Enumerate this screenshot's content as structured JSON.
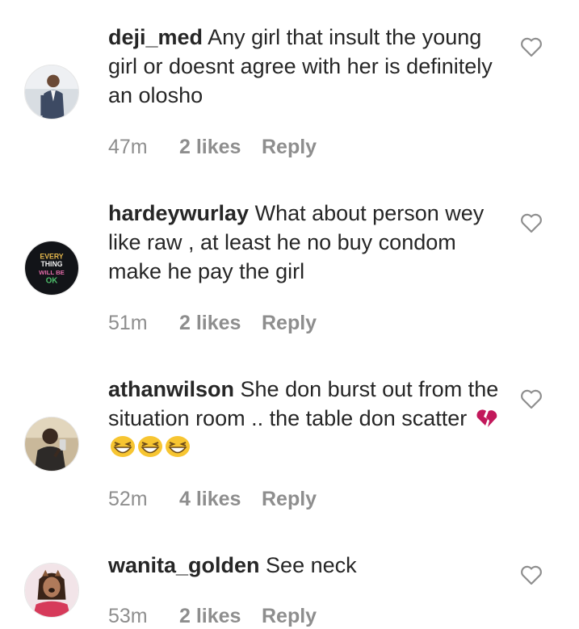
{
  "comments": [
    {
      "username": "deji_med",
      "text": "Any girl that insult the young girl or doesnt agree with her is definitely an olosho",
      "time": "47m",
      "likes": "2 likes",
      "reply": "Reply",
      "avatar_icon": "man-in-suit-avatar"
    },
    {
      "username": "hardeywurlay",
      "text": "What about person wey like raw , at least he no buy condom make he pay the girl",
      "time": "51m",
      "likes": "2 likes",
      "reply": "Reply",
      "avatar_icon": "text-graphic-avatar",
      "avatar_text": [
        "EVERY",
        "THING",
        "WILL BE",
        "OK"
      ]
    },
    {
      "username": "athanwilson",
      "text": "She don burst out from the situation room .. the table don scatter",
      "emojis": [
        "broken-heart-emoji",
        "grinning-squinting-face-emoji",
        "grinning-squinting-face-emoji",
        "grinning-squinting-face-emoji"
      ],
      "time": "52m",
      "likes": "4 likes",
      "reply": "Reply",
      "avatar_icon": "selfie-man-avatar"
    },
    {
      "username": "wanita_golden",
      "text": "See neck",
      "time": "53m",
      "likes": "2 likes",
      "reply": "Reply",
      "avatar_icon": "woman-filter-avatar"
    }
  ],
  "colors": {
    "text": "#262626",
    "meta": "#8e8e8e",
    "heart_stroke": "#8e8e8e",
    "background": "#ffffff"
  },
  "icons": {
    "like": "heart-outline-icon"
  }
}
